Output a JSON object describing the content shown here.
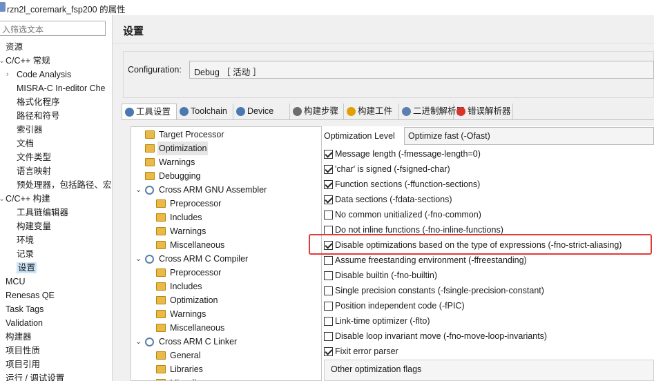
{
  "window": {
    "title": "rzn2l_coremark_fsp200 的属性"
  },
  "filter": {
    "placeholder": "入筛选文本"
  },
  "nav": {
    "items": [
      {
        "label": "资源",
        "level": 0,
        "arrow": ""
      },
      {
        "label": "C/C++ 常规",
        "level": 0,
        "arrow": "⌄"
      },
      {
        "label": "Code Analysis",
        "level": 1,
        "arrow": "›"
      },
      {
        "label": "MISRA-C In-editor Che",
        "level": 1,
        "arrow": ""
      },
      {
        "label": "格式化程序",
        "level": 1,
        "arrow": ""
      },
      {
        "label": "路径和符号",
        "level": 1,
        "arrow": ""
      },
      {
        "label": "索引器",
        "level": 1,
        "arrow": ""
      },
      {
        "label": "文档",
        "level": 1,
        "arrow": ""
      },
      {
        "label": "文件类型",
        "level": 1,
        "arrow": ""
      },
      {
        "label": "语言映射",
        "level": 1,
        "arrow": ""
      },
      {
        "label": "预处理器，包括路径、宏",
        "level": 1,
        "arrow": ""
      },
      {
        "label": "C/C++ 构建",
        "level": 0,
        "arrow": "⌄"
      },
      {
        "label": "工具链编辑器",
        "level": 1,
        "arrow": ""
      },
      {
        "label": "构建变量",
        "level": 1,
        "arrow": ""
      },
      {
        "label": "环境",
        "level": 1,
        "arrow": ""
      },
      {
        "label": "记录",
        "level": 1,
        "arrow": ""
      },
      {
        "label": "设置",
        "level": 1,
        "arrow": "",
        "selected": true
      },
      {
        "label": "MCU",
        "level": 0,
        "arrow": ""
      },
      {
        "label": "Renesas QE",
        "level": 0,
        "arrow": ""
      },
      {
        "label": "Task Tags",
        "level": 0,
        "arrow": ""
      },
      {
        "label": "Validation",
        "level": 0,
        "arrow": ""
      },
      {
        "label": "构建器",
        "level": 0,
        "arrow": ""
      },
      {
        "label": "项目性质",
        "level": 0,
        "arrow": ""
      },
      {
        "label": "项目引用",
        "level": 0,
        "arrow": ""
      },
      {
        "label": "运行 / 调试设置",
        "level": 0,
        "arrow": ""
      }
    ]
  },
  "main": {
    "heading": "设置",
    "configuration_label": "Configuration:",
    "configuration_value": "Debug ［ 活动 ］"
  },
  "tabs": [
    {
      "label": "工具设置",
      "icon": "tool-settings-icon",
      "active": true
    },
    {
      "label": "Toolchain",
      "icon": "toolchain-icon"
    },
    {
      "label": "Device",
      "icon": "device-icon"
    },
    {
      "label": "构建步骤",
      "icon": "build-steps-icon"
    },
    {
      "label": "构建工件",
      "icon": "build-artifact-icon"
    },
    {
      "label": "二进制解析器",
      "icon": "binary-parser-icon"
    },
    {
      "label": "错误解析器",
      "icon": "error-parser-icon"
    }
  ],
  "tree": [
    {
      "label": "Target Processor",
      "kind": "folder",
      "depth": 0
    },
    {
      "label": "Optimization",
      "kind": "folder",
      "depth": 0,
      "selected": true
    },
    {
      "label": "Warnings",
      "kind": "folder",
      "depth": 0
    },
    {
      "label": "Debugging",
      "kind": "folder",
      "depth": 0
    },
    {
      "label": "Cross ARM GNU Assembler",
      "kind": "gear",
      "depth": 0,
      "expanded": true
    },
    {
      "label": "Preprocessor",
      "kind": "folder",
      "depth": 1
    },
    {
      "label": "Includes",
      "kind": "folder",
      "depth": 1
    },
    {
      "label": "Warnings",
      "kind": "folder",
      "depth": 1
    },
    {
      "label": "Miscellaneous",
      "kind": "folder",
      "depth": 1
    },
    {
      "label": "Cross ARM C Compiler",
      "kind": "gear",
      "depth": 0,
      "expanded": true
    },
    {
      "label": "Preprocessor",
      "kind": "folder",
      "depth": 1
    },
    {
      "label": "Includes",
      "kind": "folder",
      "depth": 1
    },
    {
      "label": "Optimization",
      "kind": "folder",
      "depth": 1
    },
    {
      "label": "Warnings",
      "kind": "folder",
      "depth": 1
    },
    {
      "label": "Miscellaneous",
      "kind": "folder",
      "depth": 1
    },
    {
      "label": "Cross ARM C Linker",
      "kind": "gear",
      "depth": 0,
      "expanded": true
    },
    {
      "label": "General",
      "kind": "folder",
      "depth": 1
    },
    {
      "label": "Libraries",
      "kind": "folder",
      "depth": 1
    },
    {
      "label": "Miscellaneous",
      "kind": "folder",
      "depth": 1
    }
  ],
  "optimization": {
    "level_label": "Optimization Level",
    "level_value": "Optimize fast (-Ofast)",
    "options": [
      {
        "label": "Message length (-fmessage-length=0)",
        "checked": true
      },
      {
        "label": "'char' is signed (-fsigned-char)",
        "checked": true
      },
      {
        "label": "Function sections (-ffunction-sections)",
        "checked": true
      },
      {
        "label": "Data sections (-fdata-sections)",
        "checked": true
      },
      {
        "label": "No common unitialized (-fno-common)",
        "checked": false
      },
      {
        "label": "Do not inline functions (-fno-inline-functions)",
        "checked": false
      },
      {
        "label": "Disable optimizations based on the type of expressions (-fno-strict-aliasing)",
        "checked": true,
        "highlighted": true
      },
      {
        "label": "Assume freestanding environment (-ffreestanding)",
        "checked": false
      },
      {
        "label": "Disable builtin (-fno-builtin)",
        "checked": false
      },
      {
        "label": "Single precision constants (-fsingle-precision-constant)",
        "checked": false
      },
      {
        "label": "Position independent code (-fPIC)",
        "checked": false
      },
      {
        "label": "Link-time optimizer (-flto)",
        "checked": false
      },
      {
        "label": "Disable loop invariant move (-fno-move-loop-invariants)",
        "checked": false
      },
      {
        "label": "Fixit error parser",
        "checked": true
      }
    ],
    "other_flags_label": "Other optimization flags"
  }
}
